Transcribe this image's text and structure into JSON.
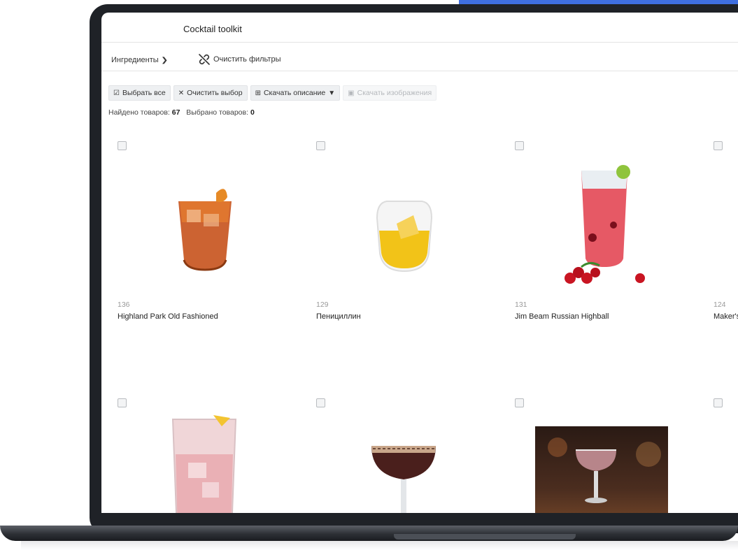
{
  "app": {
    "title": "Cocktail toolkit"
  },
  "filters": {
    "ingredients_label": "Ингредиенты",
    "clear_filters_label": "Очистить фильтры"
  },
  "toolbar": {
    "select_all": "Выбрать все",
    "clear_selection": "Очистить выбор",
    "download_description": "Скачать описание",
    "download_images": "Скачать изображения"
  },
  "summary": {
    "found_label": "Найдено товаров:",
    "found_count": "67",
    "selected_label": "Выбрано товаров:",
    "selected_count": "0"
  },
  "products": [
    {
      "id": "136",
      "name": "Highland Park Old Fashioned",
      "icon": "old-fashioned-glass"
    },
    {
      "id": "129",
      "name": "Пенициллин",
      "icon": "yellow-cocktail-glass"
    },
    {
      "id": "131",
      "name": "Jim Beam Russian Highball",
      "icon": "red-highball-glass"
    },
    {
      "id": "124",
      "name": "Maker's I",
      "icon": "cocktail"
    },
    {
      "id": "",
      "name": "",
      "icon": "cherry-highball-glass"
    },
    {
      "id": "",
      "name": "",
      "icon": "espresso-martini-glass"
    },
    {
      "id": "",
      "name": "",
      "icon": "coupe-bar-photo"
    },
    {
      "id": "",
      "name": "",
      "icon": "cocktail"
    }
  ],
  "colors": {
    "accent": "#3f6fe0",
    "bezel": "#1f2227",
    "button_bg": "#eef0f2"
  }
}
